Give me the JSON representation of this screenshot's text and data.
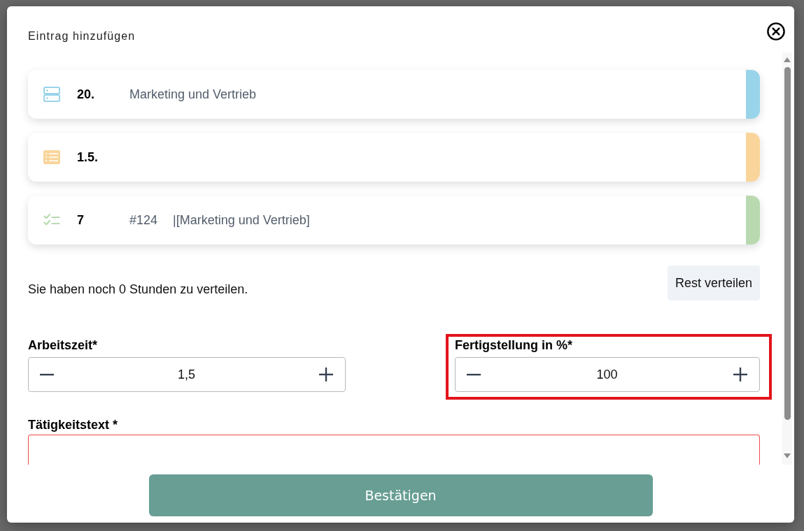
{
  "dialog": {
    "title": "Eintrag hinzufügen"
  },
  "entries": [
    {
      "kind": "server",
      "color": "#9ad4ea",
      "number": "20.",
      "texts": [
        "Marketing und Vertrieb"
      ]
    },
    {
      "kind": "list",
      "color": "#f9d59b",
      "number": "1.5."
    },
    {
      "kind": "checklist",
      "color": "#b9dab0",
      "number": "7",
      "texts": [
        "#124",
        "|[Marketing und Vertrieb]"
      ]
    }
  ],
  "remaining": {
    "message": "Sie haben noch 0 Stunden zu verteilen.",
    "button": "Rest verteilen"
  },
  "fields": [
    {
      "label": "Arbeitszeit*",
      "value": "1,5",
      "highlighted": false
    },
    {
      "label": "Fertigstellung in %*",
      "value": "100",
      "highlighted": true
    }
  ],
  "activity": {
    "label": "Tätigkeitstext *",
    "invalid": true
  },
  "confirm_button": "Bestätigen"
}
